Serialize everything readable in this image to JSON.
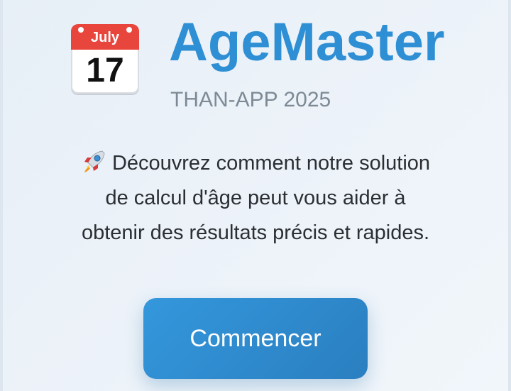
{
  "header": {
    "calendar_month": "July",
    "calendar_day": "17",
    "title": "AgeMaster",
    "subtitle": "THAN-APP 2025"
  },
  "intro": {
    "icon": "rocket-icon",
    "text_line1": "Découvrez comment notre solution",
    "text_line2": "de calcul d'âge peut vous aider à",
    "text_line3": "obtenir des résultats précis et rapides."
  },
  "cta": {
    "label": "Commencer"
  },
  "colors": {
    "accent": "#2f8fd4",
    "button": "#2a88cc",
    "background": "#eaf1f8"
  }
}
